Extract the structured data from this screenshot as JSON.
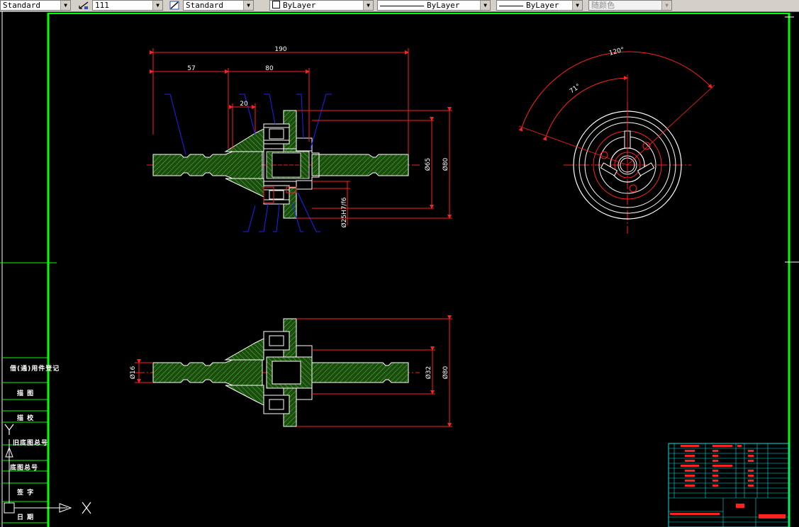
{
  "toolbar": {
    "text_style": "Standard",
    "dim_style": "111",
    "table_style": "Standard",
    "layer": "ByLayer",
    "linetype": "ByLayer",
    "lineweight": "ByLayer",
    "plot_color": "随颜色"
  },
  "drawing": {
    "dims_top": {
      "overall_length": "190",
      "left_length": "57",
      "mid_length": "80",
      "hub_length": "20",
      "dia_inner": "Ø65",
      "dia_outer": "Ø80",
      "fit": "Ø25H7/f6"
    },
    "dims_bottom": {
      "dia_shaft": "Ø16",
      "dia_mid": "Ø32",
      "dia_outer": "Ø80"
    },
    "side_view": {
      "angle_outer": "120°",
      "angle_inner": "71°"
    }
  },
  "left_panel": {
    "labels": [
      "借(通)用件登记",
      "描 图",
      "描 校",
      "旧底图总号",
      "底图总号",
      "签 字",
      "日 期"
    ]
  },
  "ucs": {
    "x_label": "X",
    "y_label": "Y"
  },
  "colors": {
    "background": "#000000",
    "border": "#00ff00",
    "dimension": "#ff0000",
    "outline": "#ffffff",
    "hatch": "#00cc00",
    "leader": "#0000ff",
    "titleblock": "#00ffff"
  }
}
